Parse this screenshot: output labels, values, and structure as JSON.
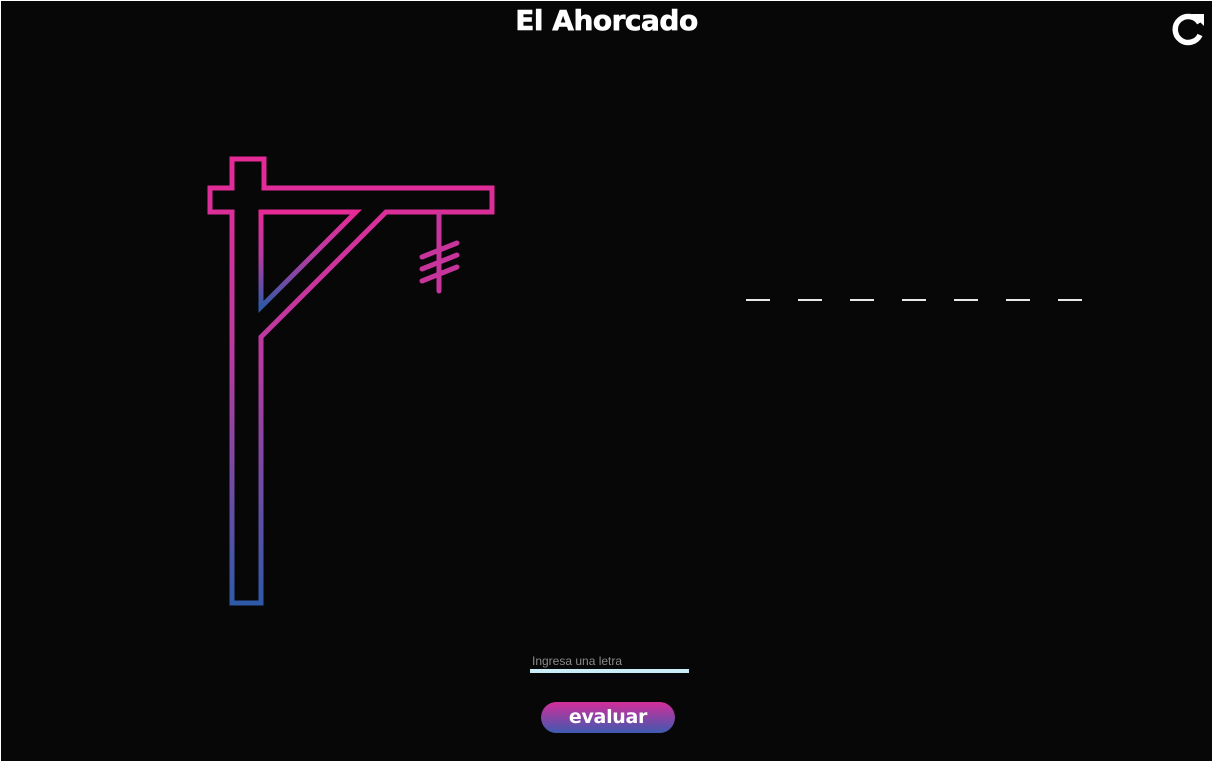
{
  "header": {
    "title": "El Ahorcado"
  },
  "controls": {
    "restart_icon": "restart-icon"
  },
  "drawing": {
    "gradient_top": "#e62a96",
    "gradient_bottom": "#2e5aa8"
  },
  "word": {
    "slots": [
      "",
      "",
      "",
      "",
      "",
      "",
      ""
    ]
  },
  "input": {
    "placeholder": "Ingresa una letra",
    "value": ""
  },
  "actions": {
    "evaluate_label": "evaluar"
  }
}
